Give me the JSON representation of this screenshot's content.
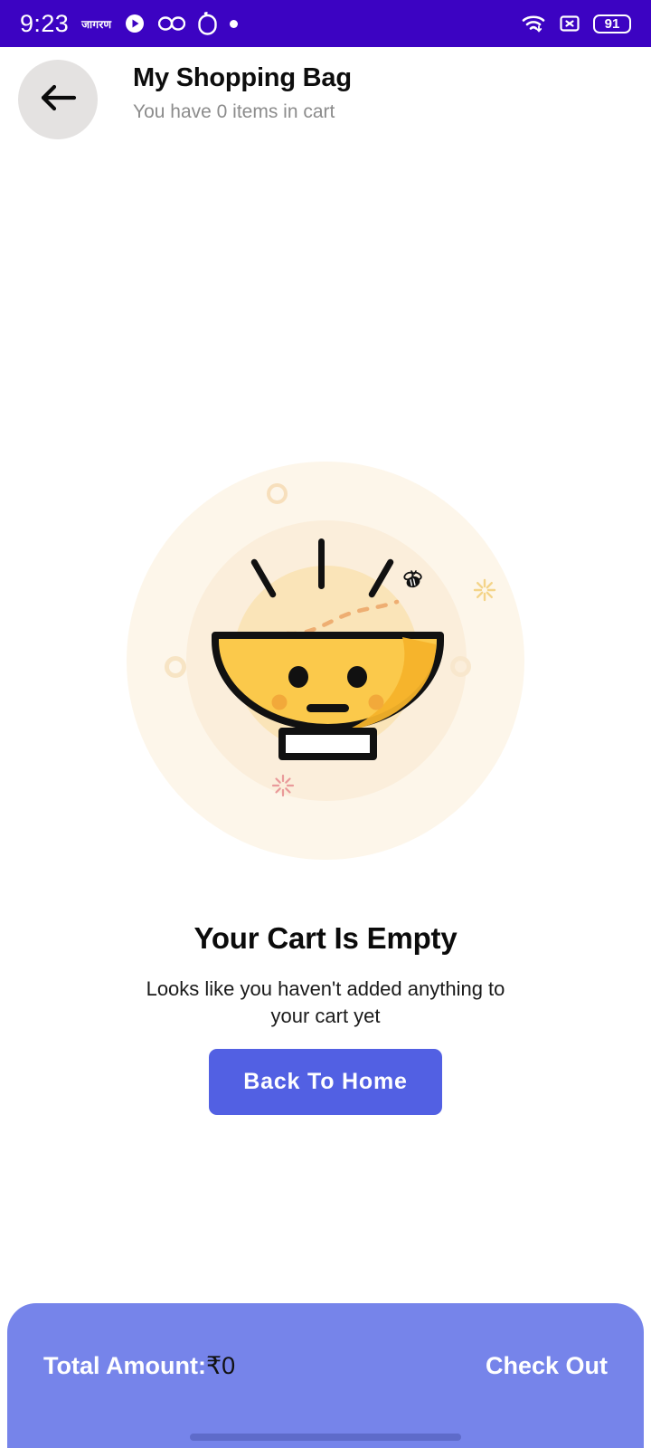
{
  "status_bar": {
    "time": "9:23",
    "app_label": "जागरण",
    "icons": [
      "play-circle-icon",
      "glasses-icon",
      "mouse-outline-icon",
      "dot-icon"
    ],
    "wifi_icon": "wifi-icon",
    "sim_icon": "no-sim-icon",
    "battery_level": "91",
    "background_color": "#3c03c2"
  },
  "header": {
    "back_icon": "back-arrow-icon",
    "title": "My Shopping Bag",
    "subtitle": "You have 0 items in cart"
  },
  "empty_state": {
    "illustration": "empty-bowl-illustration",
    "title": "Your Cart Is Empty",
    "message": "Looks like you haven't added anything to your cart yet",
    "button_label": "Back To Home",
    "button_color": "#5260e3"
  },
  "bottom_bar": {
    "total_label": "Total Amount:",
    "total_amount": "₹0",
    "checkout_label": "Check Out",
    "background_color": "#7684ea"
  }
}
